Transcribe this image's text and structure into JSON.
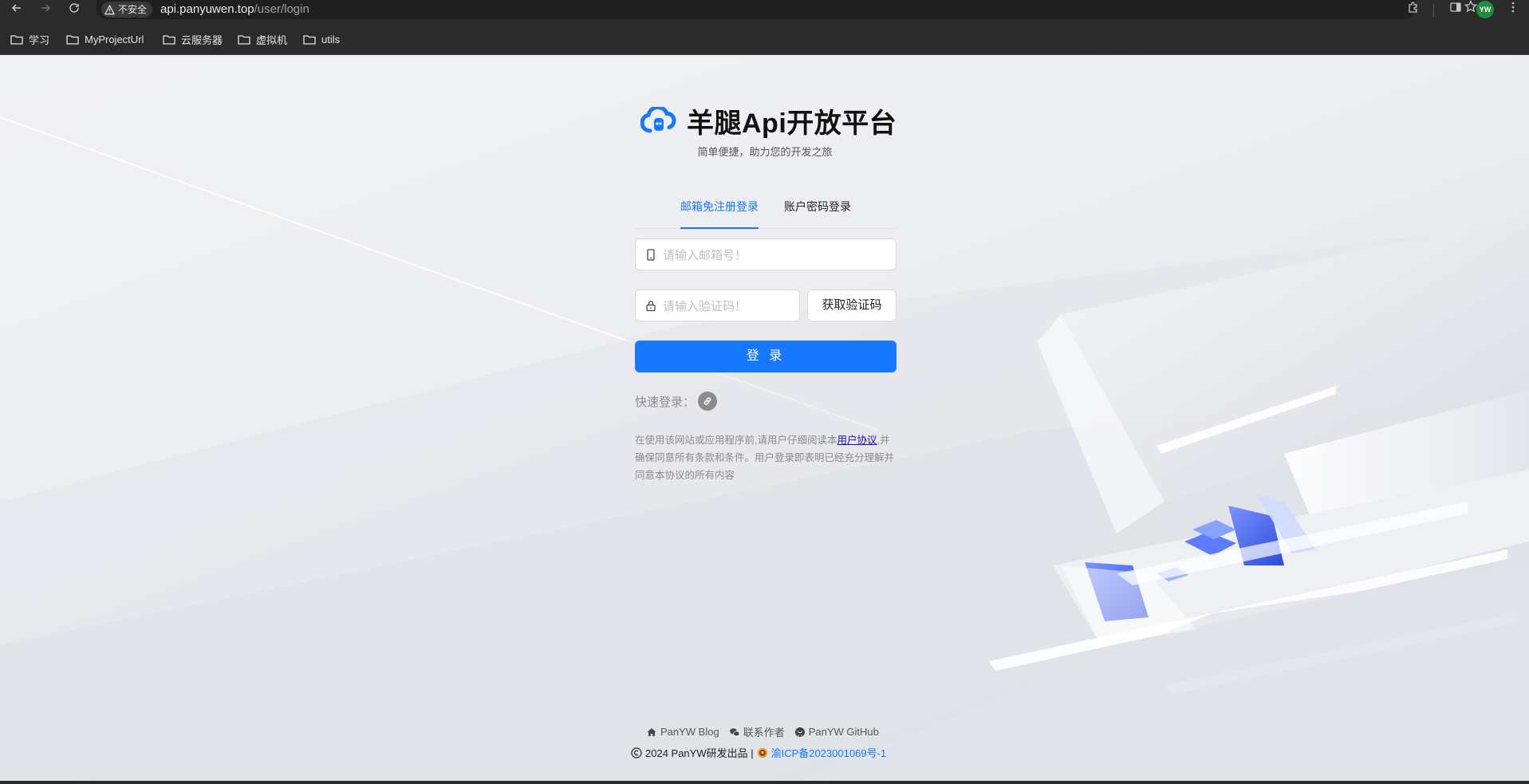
{
  "browser": {
    "security_label": "不安全",
    "url_host": "api.panyuwen.top",
    "url_path": "/user/login",
    "profile_initials": "YW",
    "icons": [
      "back-arrow-icon",
      "forward-arrow-icon",
      "reload-icon",
      "warning-icon",
      "star-icon",
      "extensions-icon",
      "side-panel-icon",
      "menu-icon"
    ]
  },
  "bookmarks": [
    {
      "label": "学习"
    },
    {
      "label": "MyProjectUrl"
    },
    {
      "label": "云服务器"
    },
    {
      "label": "虚拟机"
    },
    {
      "label": "utils"
    }
  ],
  "brand": {
    "title": "羊腿Api开放平台",
    "slogan": "简单便捷，助力您的开发之旅"
  },
  "tabs": [
    {
      "label": "邮箱免注册登录",
      "active": true
    },
    {
      "label": "账户密码登录",
      "active": false
    }
  ],
  "form": {
    "email_placeholder": "请输入邮箱号！",
    "code_placeholder": "请输入验证码！",
    "get_code_label": "获取验证码",
    "login_label": "登 录",
    "quick_login_label": "快速登录："
  },
  "agreement": {
    "text_before": "在使用该网站或应用程序前,请用户仔细阅读本",
    "link": "用户协议",
    "text_after": ",并确保同意所有条款和条件。用户登录即表明已经充分理解并同意本协议的所有内容"
  },
  "footer": {
    "blog": "PanYW Blog",
    "contact": "联系作者",
    "github": "PanYW GitHub",
    "copyright": "2024 PanYW研发出品 |",
    "icp": "渝ICP备2023001069号-1"
  },
  "colors": {
    "primary": "#1677ff",
    "chrome_bg": "#2b2b2b",
    "page_bg": "#eceef1"
  }
}
